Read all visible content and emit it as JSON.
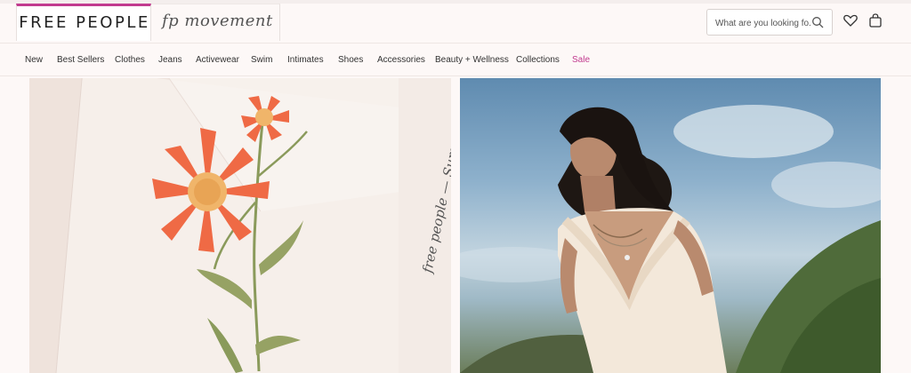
{
  "header": {
    "brand_primary": "FREE PEOPLE",
    "brand_secondary": "fp movement",
    "search": {
      "placeholder": "What are you looking fo..."
    },
    "icons": [
      "search-icon",
      "heart-icon",
      "shopping-bag-icon"
    ]
  },
  "nav": {
    "items": [
      {
        "label": "New"
      },
      {
        "label": "Best Sellers"
      },
      {
        "label": "Clothes"
      },
      {
        "label": "Jeans"
      },
      {
        "label": "Activewear"
      },
      {
        "label": "Swim"
      },
      {
        "label": "Intimates"
      },
      {
        "label": "Shoes"
      },
      {
        "label": "Accessories"
      },
      {
        "label": "Beauty + Wellness"
      },
      {
        "label": "Collections"
      },
      {
        "label": "Sale"
      }
    ]
  },
  "hero": {
    "left_script_text": "free people — Summer collection for the dy",
    "colors": {
      "accent": "#c23b8f",
      "flower": "#ef6a45",
      "stem": "#8a9a5b"
    }
  }
}
